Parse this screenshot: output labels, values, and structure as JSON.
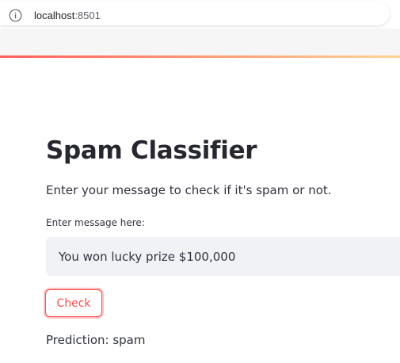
{
  "browser": {
    "url_host": "localhost",
    "url_port": ":8501"
  },
  "colors": {
    "accent": "#ff4b4b",
    "input_background": "#f0f2f6",
    "text": "#31333f"
  },
  "app": {
    "title": "Spam Classifier",
    "subtitle": "Enter your message to check if it's spam or not.",
    "input": {
      "label": "Enter message here:",
      "value": "You won lucky prize $100,000"
    },
    "check_button_label": "Check",
    "prediction": "Prediction: spam"
  },
  "icons": {
    "address_bar": "info-icon"
  }
}
